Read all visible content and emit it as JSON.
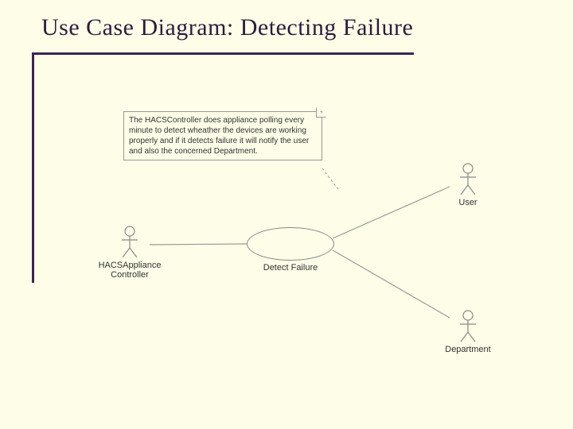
{
  "title": "Use Case Diagram: Detecting Failure",
  "note": {
    "text": "The HACSController does appliance polling every minute to detect wheather the devices are working properly and if it detects failure it will notify the user and also the concerned Department."
  },
  "actors": {
    "controller": {
      "label": "HACSAppliance\nController"
    },
    "user": {
      "label": "User"
    },
    "department": {
      "label": "Department"
    }
  },
  "usecases": {
    "detectFailure": {
      "label": "Detect Failure"
    }
  }
}
